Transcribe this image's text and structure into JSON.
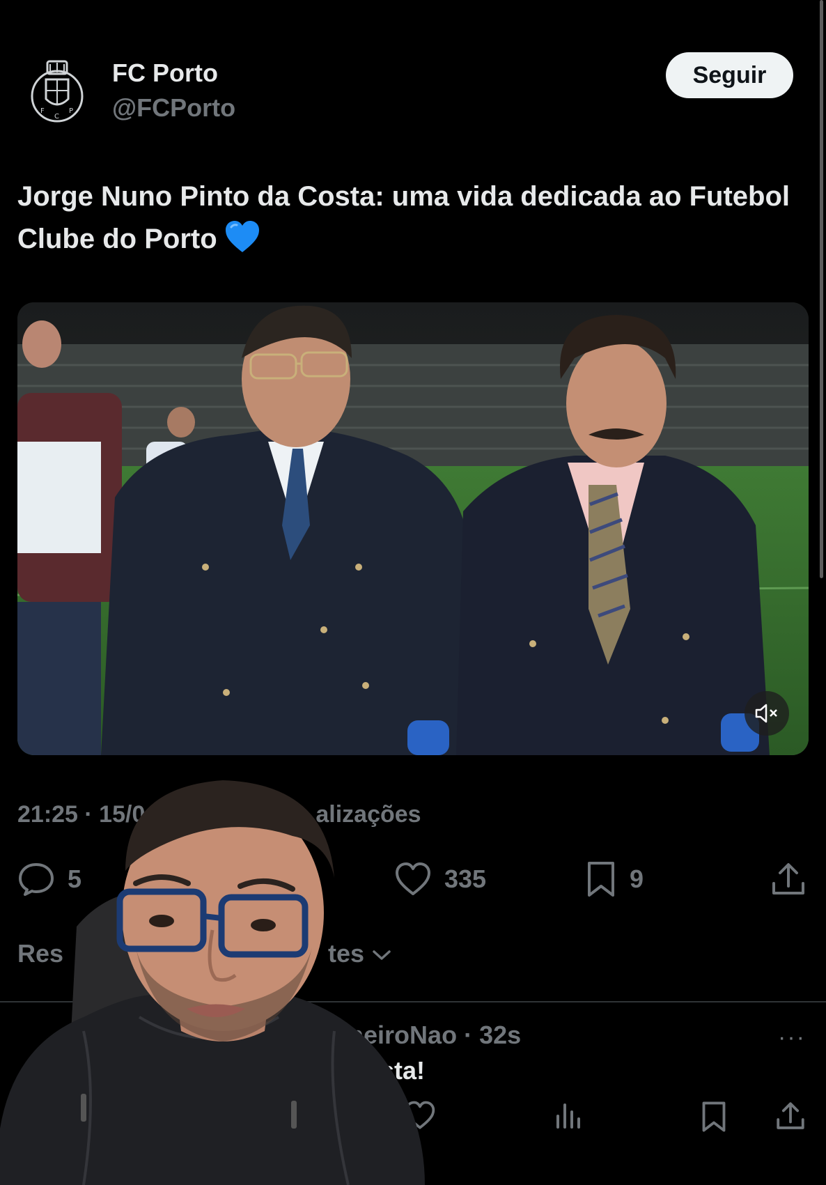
{
  "account": {
    "name": "FC Porto",
    "handle": "@FCPorto",
    "follow_label": "Seguir"
  },
  "tweet": {
    "text": "Jorge Nuno Pinto da Costa: uma vida dedicada ao Futebol Clube do Porto",
    "emoji": "💙",
    "meta_left": "21:25 · 15/0",
    "meta_right": "alizações"
  },
  "stats": {
    "replies": "5",
    "likes": "335",
    "bookmarks": "9"
  },
  "replies_sort": {
    "left": "Res",
    "right": "tes"
  },
  "reply": {
    "author": "CarneiroNao",
    "time": "· 32s",
    "text": "da costa!",
    "more": "···"
  },
  "colors": {
    "background": "#000000",
    "text": "#e7e9ea",
    "muted": "#71767b",
    "follow_bg": "#eff3f4",
    "heart_emoji": "#1d8cf5"
  },
  "icons": [
    "reply-icon",
    "like-icon",
    "bookmark-icon",
    "share-icon",
    "mute-icon",
    "chevron-down-icon",
    "views-icon",
    "more-icon"
  ]
}
